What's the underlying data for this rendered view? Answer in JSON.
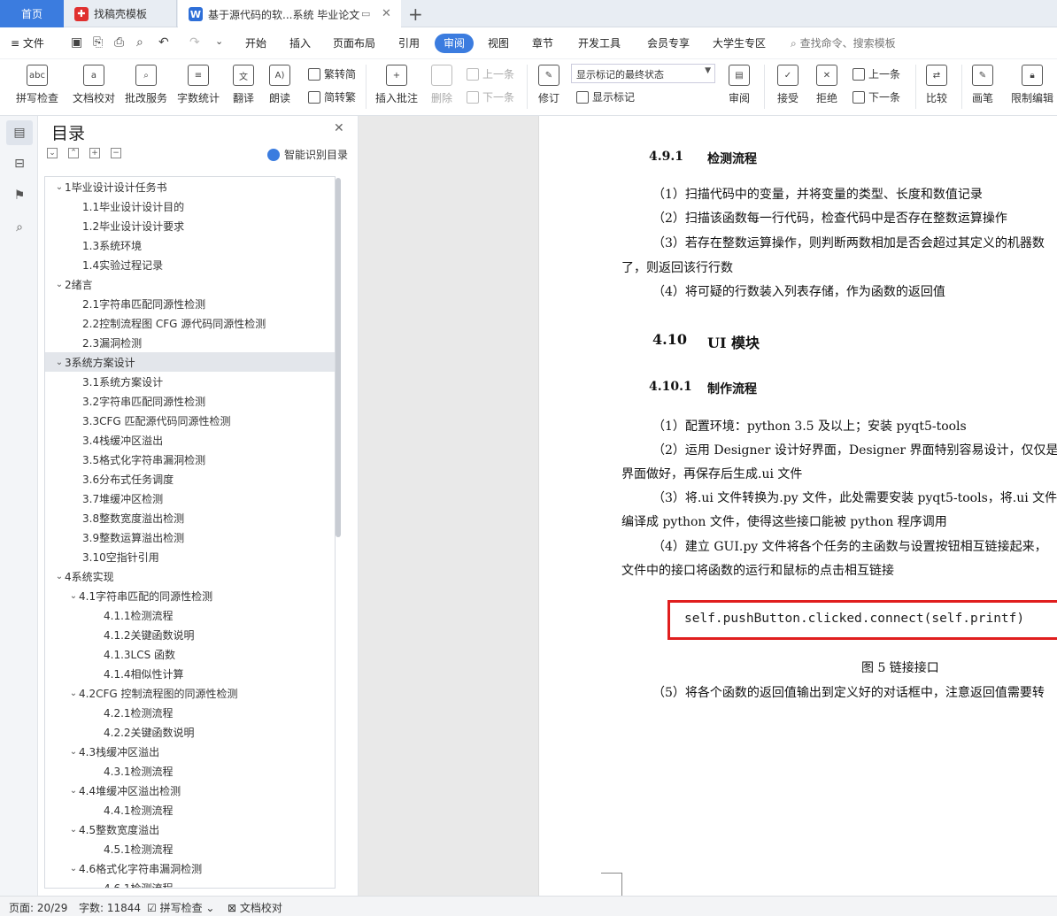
{
  "tabs": {
    "home": "首页",
    "template": "找稿壳模板",
    "doc": "基于源代码的软...系统 毕业论文"
  },
  "menu": {
    "file": "文件",
    "items": [
      "开始",
      "插入",
      "页面布局",
      "引用",
      "审阅",
      "视图",
      "章节",
      "开发工具",
      "会员专享",
      "大学生专区"
    ],
    "active": "审阅",
    "search": "查找命令、搜索模板"
  },
  "ribbon": {
    "spell": "拼写检查",
    "proofread": "文档校对",
    "revise": "批改服务",
    "wordcount": "字数统计",
    "translate": "翻译",
    "read": "朗读",
    "to_trad": "繁转简",
    "to_simp": "简转繁",
    "insert_comment": "插入批注",
    "delete": "删除",
    "prev": "上一条",
    "next": "下一条",
    "revision": "修订",
    "markup_state": "显示标记的最终状态",
    "show_markup": "显示标记",
    "review": "审阅",
    "accept": "接受",
    "reject": "拒绝",
    "prev2": "上一条",
    "next2": "下一条",
    "compare": "比较",
    "pen": "画笔",
    "restrict": "限制编辑"
  },
  "toc": {
    "title": "目录",
    "smart": "智能识别目录",
    "items": [
      {
        "t": "1毕业设计设计任务书",
        "lv": 1,
        "open": true
      },
      {
        "t": "1.1毕业设计设计目的",
        "lv": 2
      },
      {
        "t": "1.2毕业设计设计要求",
        "lv": 2
      },
      {
        "t": "1.3系统环境",
        "lv": 2
      },
      {
        "t": "1.4实验过程记录",
        "lv": 2
      },
      {
        "t": "2绪言",
        "lv": 1,
        "open": true
      },
      {
        "t": "2.1字符串匹配同源性检测",
        "lv": 2
      },
      {
        "t": "2.2控制流程图 CFG 源代码同源性检测",
        "lv": 2
      },
      {
        "t": "2.3漏洞检测",
        "lv": 2
      },
      {
        "t": "3系统方案设计",
        "lv": 1,
        "open": true,
        "sel": true
      },
      {
        "t": "3.1系统方案设计",
        "lv": 2
      },
      {
        "t": "3.2字符串匹配同源性检测",
        "lv": 2
      },
      {
        "t": "3.3CFG 匹配源代码同源性检测",
        "lv": 2
      },
      {
        "t": "3.4栈缓冲区溢出",
        "lv": 2
      },
      {
        "t": "3.5格式化字符串漏洞检测",
        "lv": 2
      },
      {
        "t": "3.6分布式任务调度",
        "lv": 2
      },
      {
        "t": "3.7堆缓冲区检测",
        "lv": 2
      },
      {
        "t": "3.8整数宽度溢出检测",
        "lv": 2
      },
      {
        "t": "3.9整数运算溢出检测",
        "lv": 2
      },
      {
        "t": "3.10空指针引用",
        "lv": 2
      },
      {
        "t": "4系统实现",
        "lv": 1,
        "open": true
      },
      {
        "t": "4.1字符串匹配的同源性检测",
        "lv": 2,
        "open": true
      },
      {
        "t": "4.1.1检测流程",
        "lv": 3
      },
      {
        "t": "4.1.2关键函数说明",
        "lv": 3
      },
      {
        "t": "4.1.3LCS 函数",
        "lv": 3
      },
      {
        "t": "4.1.4相似性计算",
        "lv": 3
      },
      {
        "t": "4.2CFG 控制流程图的同源性检测",
        "lv": 2,
        "open": true
      },
      {
        "t": "4.2.1检测流程",
        "lv": 3
      },
      {
        "t": "4.2.2关键函数说明",
        "lv": 3
      },
      {
        "t": "4.3栈缓冲区溢出",
        "lv": 2,
        "open": true
      },
      {
        "t": "4.3.1检测流程",
        "lv": 3
      },
      {
        "t": "4.4堆缓冲区溢出检测",
        "lv": 2,
        "open": true
      },
      {
        "t": "4.4.1检测流程",
        "lv": 3
      },
      {
        "t": "4.5整数宽度溢出",
        "lv": 2,
        "open": true
      },
      {
        "t": "4.5.1检测流程",
        "lv": 3
      },
      {
        "t": "4.6格式化字符串漏洞检测",
        "lv": 2,
        "open": true
      },
      {
        "t": "4.6.1检测流程",
        "lv": 3
      }
    ]
  },
  "doc": {
    "h491_num": "4.9.1",
    "h491_title": "检测流程",
    "p1": "（1）扫描代码中的变量，并将变量的类型、长度和数值记录",
    "p2": "（2）扫描该函数每一行代码，检查代码中是否存在整数运算操作",
    "p3a": "（3）若存在整数运算操作，则判断两数相加是否会超过其定义的机器数",
    "p3b": "了，则返回该行行数",
    "p4": "（4）将可疑的行数装入列表存储，作为函数的返回值",
    "h410_num": "4.10",
    "h410_title": "UI 模块",
    "h4101_num": "4.10.1",
    "h4101_title": "制作流程",
    "q1": "（1）配置环境：python 3.5 及以上；安装 pyqt5-tools",
    "q2a": "（2）运用 Designer 设计好界面，Designer 界面特别容易设计，仅仅是拖",
    "q2b": "界面做好，再保存后生成.ui 文件",
    "q3a": "（3）将.ui 文件转换为.py 文件，此处需要安装 pyqt5-tools，将.ui 文件用",
    "q3b": "编译成 python 文件，使得这些接口能被 python 程序调用",
    "q4a": "（4）建立 GUI.py 文件将各个任务的主函数与设置按钮相互链接起来，",
    "q4b": "文件中的接口将函数的运行和鼠标的点击相互链接",
    "code": "self.pushButton.clicked.connect(self.printf)",
    "caption": "图 5 链接接口",
    "q5": "（5）将各个函数的返回值输出到定义好的对话框中，注意返回值需要转"
  },
  "status": {
    "page": "页面: 20/29",
    "words": "字数: 11844",
    "spell": "拼写检查",
    "proof": "文档校对"
  },
  "colors": {
    "accent": "#3b7cdf",
    "highlight_border": "#e01e1e"
  }
}
